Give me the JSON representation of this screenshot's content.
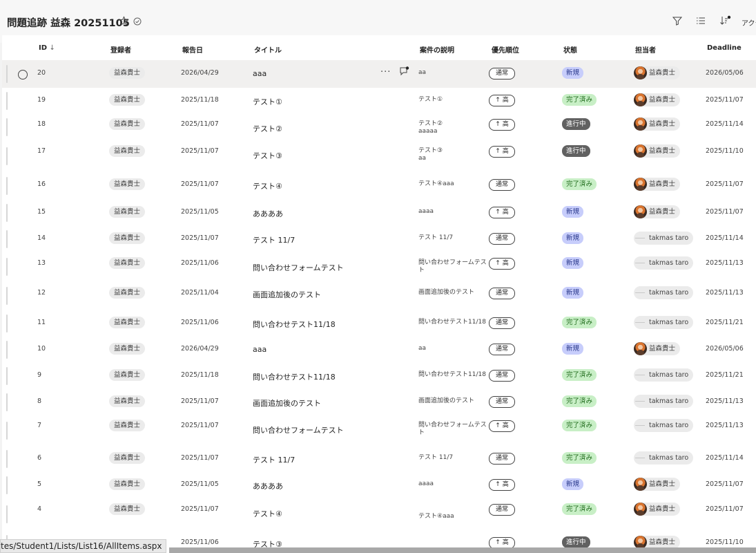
{
  "header": {
    "title": "問題追跡 益森 20251105",
    "more_label": "アクテ"
  },
  "columns": {
    "id": "ID",
    "registrant": "登録者",
    "report_date": "報告日",
    "title": "タイトル",
    "description": "案件の説明",
    "priority": "優先順位",
    "status": "状態",
    "assignee": "担当者",
    "deadline": "Deadline"
  },
  "rows": [
    {
      "id": "20",
      "registrant": "益森貴士",
      "date": "2026/04/29",
      "title": "aaa",
      "desc": [
        "aa"
      ],
      "priority": "通常",
      "status": "新規",
      "status_type": "new",
      "assignee": "益森貴士",
      "avatar": "photo",
      "deadline": "2026/05/06",
      "selected": true
    },
    {
      "id": "19",
      "registrant": "益森貴士",
      "date": "2025/11/18",
      "title": "テスト①",
      "desc": [
        "テスト①"
      ],
      "priority": "↑ 高",
      "status": "完了済み",
      "status_type": "done",
      "assignee": "益森貴士",
      "avatar": "photo",
      "deadline": "2025/11/07"
    },
    {
      "id": "18",
      "registrant": "益森貴士",
      "date": "2025/11/07",
      "title": "テスト②",
      "desc": [
        "テスト②",
        "aaaaa"
      ],
      "priority": "↑ 高",
      "status": "進行中",
      "status_type": "prog",
      "assignee": "益森貴士",
      "avatar": "photo",
      "deadline": "2025/11/14"
    },
    {
      "id": "17",
      "registrant": "益森貴士",
      "date": "2025/11/07",
      "title": "テスト③",
      "desc": [
        "テスト③",
        "aa"
      ],
      "priority": "↑ 高",
      "status": "進行中",
      "status_type": "prog",
      "assignee": "益森貴士",
      "avatar": "photo",
      "deadline": "2025/11/10"
    },
    {
      "id": "16",
      "registrant": "益森貴士",
      "date": "2025/11/07",
      "title": "テスト④",
      "desc": [
        "テスト④aaa"
      ],
      "priority": "通常",
      "status": "完了済み",
      "status_type": "done",
      "assignee": "益森貴士",
      "avatar": "photo",
      "deadline": "2025/11/07"
    },
    {
      "id": "15",
      "registrant": "益森貴士",
      "date": "2025/11/05",
      "title": "ああああ",
      "desc": [
        "aaaa"
      ],
      "priority": "↑ 高",
      "status": "新規",
      "status_type": "new",
      "assignee": "益森貴士",
      "avatar": "photo",
      "deadline": "2025/11/07"
    },
    {
      "id": "14",
      "registrant": "益森貴士",
      "date": "2025/11/07",
      "title": "テスト 11/7",
      "desc": [
        "テスト 11/7"
      ],
      "priority": "通常",
      "status": "新規",
      "status_type": "new",
      "assignee": "takmas taro",
      "avatar": "blank",
      "deadline": "2025/11/14"
    },
    {
      "id": "13",
      "registrant": "益森貴士",
      "date": "2025/11/06",
      "title": "問い合わせフォームテスト",
      "desc": [
        "問い合わせフォームテス",
        "ト"
      ],
      "priority": "↑ 高",
      "status": "新規",
      "status_type": "new",
      "assignee": "takmas taro",
      "avatar": "blank",
      "deadline": "2025/11/13"
    },
    {
      "id": "12",
      "registrant": "益森貴士",
      "date": "2025/11/04",
      "title": "画面追加後のテスト",
      "desc": [
        "画面追加後のテスト"
      ],
      "priority": "通常",
      "status": "新規",
      "status_type": "new",
      "assignee": "takmas taro",
      "avatar": "blank",
      "deadline": "2025/11/13"
    },
    {
      "id": "11",
      "registrant": "益森貴士",
      "date": "2025/11/06",
      "title": "問い合わせテスト11/18",
      "desc": [
        "問い合わせテスト11/18"
      ],
      "priority": "通常",
      "status": "完了済み",
      "status_type": "done",
      "assignee": "takmas taro",
      "avatar": "blank",
      "deadline": "2025/11/21"
    },
    {
      "id": "10",
      "registrant": "益森貴士",
      "date": "2026/04/29",
      "title": "aaa",
      "desc": [
        "aa"
      ],
      "priority": "通常",
      "status": "新規",
      "status_type": "new",
      "assignee": "益森貴士",
      "avatar": "photo",
      "deadline": "2026/05/06"
    },
    {
      "id": "9",
      "registrant": "益森貴士",
      "date": "2025/11/18",
      "title": "問い合わせテスト11/18",
      "desc": [
        "問い合わせテスト11/18"
      ],
      "priority": "通常",
      "status": "完了済み",
      "status_type": "done",
      "assignee": "takmas taro",
      "avatar": "blank",
      "deadline": "2025/11/21"
    },
    {
      "id": "8",
      "registrant": "益森貴士",
      "date": "2025/11/07",
      "title": "画面追加後のテスト",
      "desc": [
        "画面追加後のテスト"
      ],
      "priority": "通常",
      "status": "完了済み",
      "status_type": "done",
      "assignee": "takmas taro",
      "avatar": "blank",
      "deadline": "2025/11/13"
    },
    {
      "id": "7",
      "registrant": "益森貴士",
      "date": "2025/11/07",
      "title": "問い合わせフォームテスト",
      "desc": [
        "問い合わせフォームテス",
        "ト"
      ],
      "priority": "↑ 高",
      "status": "完了済み",
      "status_type": "done",
      "assignee": "takmas taro",
      "avatar": "blank",
      "deadline": "2025/11/13"
    },
    {
      "id": "6",
      "registrant": "益森貴士",
      "date": "2025/11/07",
      "title": "テスト 11/7",
      "desc": [
        "テスト 11/7"
      ],
      "priority": "通常",
      "status": "完了済み",
      "status_type": "done",
      "assignee": "takmas taro",
      "avatar": "blank",
      "deadline": "2025/11/14"
    },
    {
      "id": "5",
      "registrant": "益森貴士",
      "date": "2025/11/05",
      "title": "ああああ",
      "desc": [
        "aaaa"
      ],
      "priority": "↑ 高",
      "status": "新規",
      "status_type": "new",
      "assignee": "益森貴士",
      "avatar": "photo",
      "deadline": "2025/11/07"
    },
    {
      "id": "4",
      "registrant": "益森貴士",
      "date": "2025/11/07",
      "title": "テスト④",
      "desc": [
        "",
        "テスト④aaa"
      ],
      "priority": "通常",
      "status": "完了済み",
      "status_type": "done",
      "assignee": "益森貴士",
      "avatar": "photo",
      "deadline": "2025/11/07"
    },
    {
      "id": "",
      "registrant": "",
      "date": "2025/11/06",
      "title": "テスト③",
      "desc": [
        ""
      ],
      "priority": "↑ 高",
      "status": "進行中",
      "status_type": "prog",
      "assignee": "益森貴士",
      "avatar": "photo",
      "deadline": "2025/11/10"
    }
  ],
  "statusbar": {
    "url": "tes/Student1/Lists/List16/AllItems.aspx"
  },
  "icons": {
    "favorite": "star-icon",
    "sync": "check-circle-icon",
    "filter": "filter-icon",
    "view": "list-view-icon",
    "sort": "sort-icon",
    "select": "radio-icon",
    "more": "more-icon",
    "comment": "comment-icon"
  },
  "colors": {
    "status_new": "#c7cdfb",
    "status_done": "#c8efc6",
    "status_progress": "#616161"
  }
}
